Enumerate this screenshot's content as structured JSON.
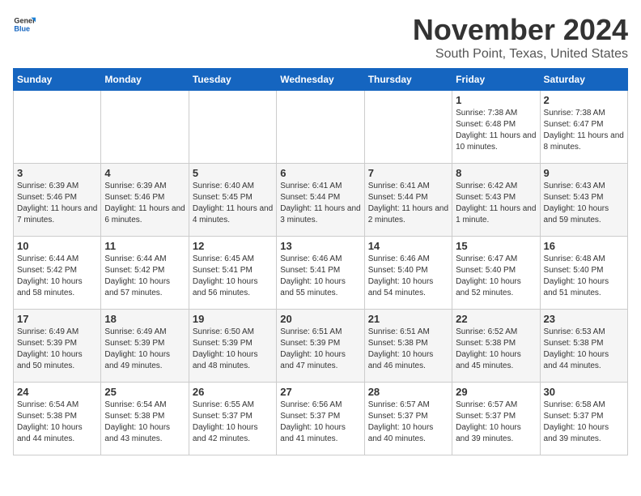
{
  "logo": {
    "text_general": "General",
    "text_blue": "Blue"
  },
  "title": "November 2024",
  "subtitle": "South Point, Texas, United States",
  "days_of_week": [
    "Sunday",
    "Monday",
    "Tuesday",
    "Wednesday",
    "Thursday",
    "Friday",
    "Saturday"
  ],
  "weeks": [
    [
      {
        "day": "",
        "info": ""
      },
      {
        "day": "",
        "info": ""
      },
      {
        "day": "",
        "info": ""
      },
      {
        "day": "",
        "info": ""
      },
      {
        "day": "",
        "info": ""
      },
      {
        "day": "1",
        "info": "Sunrise: 7:38 AM\nSunset: 6:48 PM\nDaylight: 11 hours and 10 minutes."
      },
      {
        "day": "2",
        "info": "Sunrise: 7:38 AM\nSunset: 6:47 PM\nDaylight: 11 hours and 8 minutes."
      }
    ],
    [
      {
        "day": "3",
        "info": "Sunrise: 6:39 AM\nSunset: 5:46 PM\nDaylight: 11 hours and 7 minutes."
      },
      {
        "day": "4",
        "info": "Sunrise: 6:39 AM\nSunset: 5:46 PM\nDaylight: 11 hours and 6 minutes."
      },
      {
        "day": "5",
        "info": "Sunrise: 6:40 AM\nSunset: 5:45 PM\nDaylight: 11 hours and 4 minutes."
      },
      {
        "day": "6",
        "info": "Sunrise: 6:41 AM\nSunset: 5:44 PM\nDaylight: 11 hours and 3 minutes."
      },
      {
        "day": "7",
        "info": "Sunrise: 6:41 AM\nSunset: 5:44 PM\nDaylight: 11 hours and 2 minutes."
      },
      {
        "day": "8",
        "info": "Sunrise: 6:42 AM\nSunset: 5:43 PM\nDaylight: 11 hours and 1 minute."
      },
      {
        "day": "9",
        "info": "Sunrise: 6:43 AM\nSunset: 5:43 PM\nDaylight: 10 hours and 59 minutes."
      }
    ],
    [
      {
        "day": "10",
        "info": "Sunrise: 6:44 AM\nSunset: 5:42 PM\nDaylight: 10 hours and 58 minutes."
      },
      {
        "day": "11",
        "info": "Sunrise: 6:44 AM\nSunset: 5:42 PM\nDaylight: 10 hours and 57 minutes."
      },
      {
        "day": "12",
        "info": "Sunrise: 6:45 AM\nSunset: 5:41 PM\nDaylight: 10 hours and 56 minutes."
      },
      {
        "day": "13",
        "info": "Sunrise: 6:46 AM\nSunset: 5:41 PM\nDaylight: 10 hours and 55 minutes."
      },
      {
        "day": "14",
        "info": "Sunrise: 6:46 AM\nSunset: 5:40 PM\nDaylight: 10 hours and 54 minutes."
      },
      {
        "day": "15",
        "info": "Sunrise: 6:47 AM\nSunset: 5:40 PM\nDaylight: 10 hours and 52 minutes."
      },
      {
        "day": "16",
        "info": "Sunrise: 6:48 AM\nSunset: 5:40 PM\nDaylight: 10 hours and 51 minutes."
      }
    ],
    [
      {
        "day": "17",
        "info": "Sunrise: 6:49 AM\nSunset: 5:39 PM\nDaylight: 10 hours and 50 minutes."
      },
      {
        "day": "18",
        "info": "Sunrise: 6:49 AM\nSunset: 5:39 PM\nDaylight: 10 hours and 49 minutes."
      },
      {
        "day": "19",
        "info": "Sunrise: 6:50 AM\nSunset: 5:39 PM\nDaylight: 10 hours and 48 minutes."
      },
      {
        "day": "20",
        "info": "Sunrise: 6:51 AM\nSunset: 5:39 PM\nDaylight: 10 hours and 47 minutes."
      },
      {
        "day": "21",
        "info": "Sunrise: 6:51 AM\nSunset: 5:38 PM\nDaylight: 10 hours and 46 minutes."
      },
      {
        "day": "22",
        "info": "Sunrise: 6:52 AM\nSunset: 5:38 PM\nDaylight: 10 hours and 45 minutes."
      },
      {
        "day": "23",
        "info": "Sunrise: 6:53 AM\nSunset: 5:38 PM\nDaylight: 10 hours and 44 minutes."
      }
    ],
    [
      {
        "day": "24",
        "info": "Sunrise: 6:54 AM\nSunset: 5:38 PM\nDaylight: 10 hours and 44 minutes."
      },
      {
        "day": "25",
        "info": "Sunrise: 6:54 AM\nSunset: 5:38 PM\nDaylight: 10 hours and 43 minutes."
      },
      {
        "day": "26",
        "info": "Sunrise: 6:55 AM\nSunset: 5:37 PM\nDaylight: 10 hours and 42 minutes."
      },
      {
        "day": "27",
        "info": "Sunrise: 6:56 AM\nSunset: 5:37 PM\nDaylight: 10 hours and 41 minutes."
      },
      {
        "day": "28",
        "info": "Sunrise: 6:57 AM\nSunset: 5:37 PM\nDaylight: 10 hours and 40 minutes."
      },
      {
        "day": "29",
        "info": "Sunrise: 6:57 AM\nSunset: 5:37 PM\nDaylight: 10 hours and 39 minutes."
      },
      {
        "day": "30",
        "info": "Sunrise: 6:58 AM\nSunset: 5:37 PM\nDaylight: 10 hours and 39 minutes."
      }
    ]
  ]
}
